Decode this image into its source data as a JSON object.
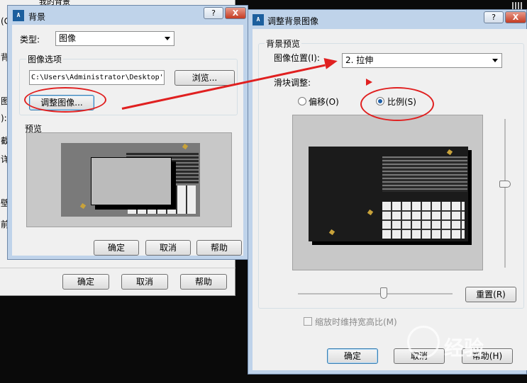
{
  "bg_window": {
    "fragments": [
      "(G",
      "背",
      "图",
      "):",
      "截",
      "详",
      "壁",
      "前"
    ],
    "header_text": "我的背景",
    "ok_label": "确定",
    "cancel_label": "取消",
    "help_label": "帮助"
  },
  "bg_dialog": {
    "title": "背景",
    "icon_text": "A",
    "help_btn": "?",
    "close_btn": "X",
    "type_label": "类型:",
    "type_value": "图像",
    "image_options_label": "图像选项",
    "path_value": "C:\\Users\\Administrator\\Desktop'",
    "browse_label": "浏览...",
    "adjust_label": "调整图像...",
    "preview_label": "预览",
    "ok_label": "确定",
    "cancel_label": "取消",
    "help_label": "帮助"
  },
  "adjust_dialog": {
    "title": "调整背景图像",
    "icon_text": "A",
    "help_btn": "?",
    "close_btn": "X",
    "preview_group_label": "背景预览",
    "position_label": "图像位置(I):",
    "position_value": "2. 拉伸",
    "slider_label": "滑块调整:",
    "offset_label": "偏移(O)",
    "scale_label": "比例(S)",
    "reset_label": "重置(R)",
    "keep_aspect_label": "缩放时维持宽高比(M)",
    "ok_label": "确定",
    "cancel_label": "取消",
    "help_label": "帮助(H)"
  },
  "watermark": "经验",
  "colors": {
    "annotation": "#e02020",
    "desktop": "#0a0a0a"
  }
}
